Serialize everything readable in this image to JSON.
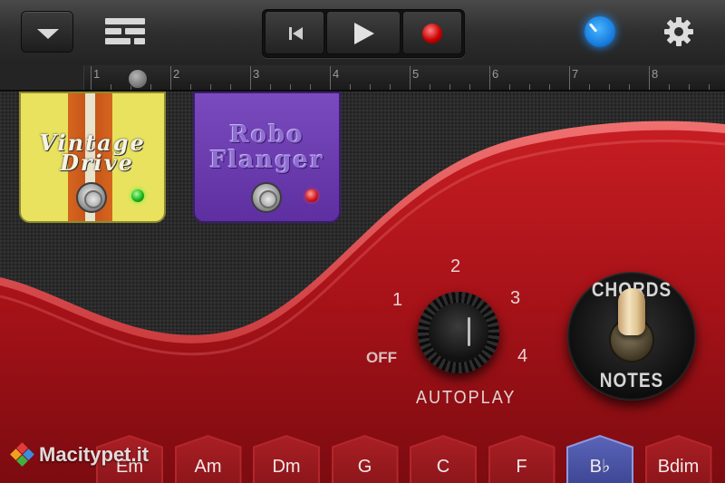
{
  "toolbar": {
    "menu": "chevron-down-icon",
    "tracks_view": "tracks-view-icon",
    "transport": {
      "rewind": "rewind-icon",
      "play": "play-icon",
      "record": "record-icon"
    },
    "smart_controls": "smart-controls-knob-icon",
    "settings": "gear-icon"
  },
  "ruler": {
    "bars": [
      "1",
      "2",
      "3",
      "4",
      "5",
      "6",
      "7",
      "8"
    ],
    "playhead_bar": 1.5
  },
  "pedals": [
    {
      "name_line1": "Vintage",
      "name_line2": "Drive",
      "led": "green",
      "color": "#e9e25f"
    },
    {
      "name": "Robo Flanger",
      "name_line1": "Robo",
      "name_line2": "Flanger",
      "led": "red",
      "color": "#6b3db0"
    }
  ],
  "autoplay": {
    "label": "AUTOPLAY",
    "positions": [
      "OFF",
      "1",
      "2",
      "3",
      "4"
    ],
    "current": "2"
  },
  "mode_switch": {
    "top_label": "CHORDS",
    "bottom_label": "NOTES",
    "current": "CHORDS"
  },
  "chords": [
    "Em",
    "Am",
    "Dm",
    "G",
    "C",
    "F",
    "B♭",
    "Bdim"
  ],
  "selected_chord": "B♭",
  "watermark": "Macitypet.it",
  "colors": {
    "guitar_body": "#b3161b",
    "selected_chord": "#4c55a8",
    "accent_blue": "#1e90ff"
  }
}
